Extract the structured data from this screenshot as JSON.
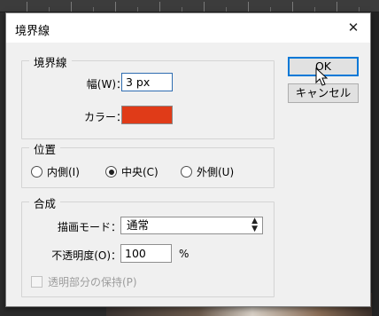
{
  "dialog": {
    "title": "境界線",
    "close_glyph": "✕"
  },
  "stroke": {
    "legend": "境界線",
    "width_label": "幅(W)：",
    "width_value": "3 px",
    "color_label": "カラー：",
    "color_hex": "#e03b18"
  },
  "position": {
    "legend": "位置",
    "options": [
      {
        "label": "内側(I)",
        "selected": false
      },
      {
        "label": "中央(C)",
        "selected": true
      },
      {
        "label": "外側(U)",
        "selected": false
      }
    ]
  },
  "blend": {
    "legend": "合成",
    "mode_label": "描画モード：",
    "mode_value": "通常",
    "opacity_label": "不透明度(O)：",
    "opacity_value": "100",
    "opacity_unit": "%",
    "preserve_label": "透明部分の保持(P)",
    "preserve_checked": false
  },
  "buttons": {
    "ok": "OK",
    "cancel": "キャンセル"
  },
  "icons": {
    "close": "close-icon",
    "cursor": "mouse-pointer-icon",
    "select_arrows": "updown-arrows-icon"
  }
}
